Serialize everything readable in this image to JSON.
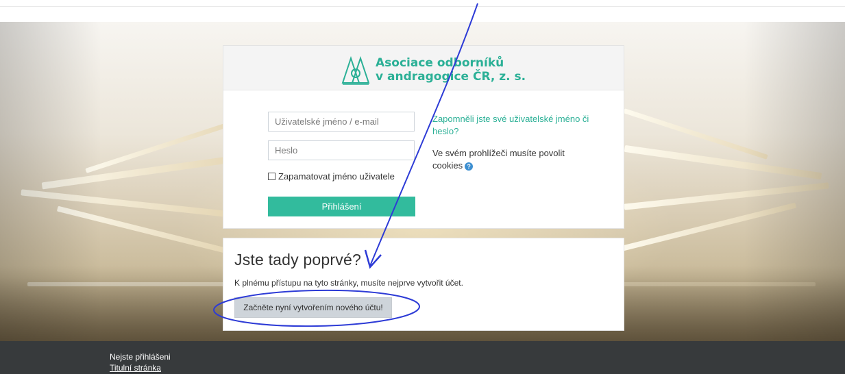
{
  "branding": {
    "logo_line1": "Asociace odborníků",
    "logo_line2": "v andragogice ČR, z. s.",
    "accent_color": "#2bb096"
  },
  "login": {
    "username_placeholder": "Uživatelské jméno / e-mail",
    "password_placeholder": "Heslo",
    "remember_label": "Zapamatovat jméno uživatele",
    "login_button": "Přihlášení",
    "forgot_link": "Zapomněli jste své uživatelské jméno či heslo?",
    "cookies_notice": "Ve svém prohlížeči musíte povolit cookies",
    "help_icon": "question-circle-icon"
  },
  "signup": {
    "title": "Jste tady poprvé?",
    "description": "K plnému přístupu na tyto stránky, musíte nejprve vytvořit účet.",
    "button_label": "Začněte nyní vytvořením nového účtu!"
  },
  "footer": {
    "status": "Nejste přihlášeni",
    "home_link": "Titulní stránka"
  },
  "annotation": {
    "color": "#2d3bd6",
    "shapes": [
      "arrow",
      "ellipse"
    ]
  }
}
